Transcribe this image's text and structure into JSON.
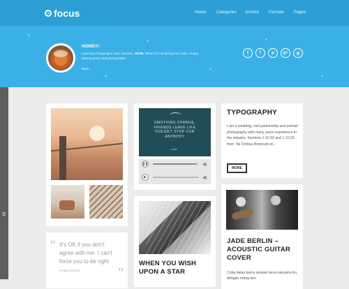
{
  "brand": {
    "name": "focus"
  },
  "nav": {
    "items": [
      "Home",
      "Categories",
      "Archive",
      "Formats",
      "Pages"
    ]
  },
  "hero": {
    "greeting": "HOWDY!",
    "intro_pre": "Learning 2 languages now: German,",
    "intro_bold": "JSON",
    "intro_post": ". When I'm not diving into code, I enjoy playing piano and photographs.",
    "more": "More..."
  },
  "socials": [
    {
      "icon": "twitter-icon",
      "glyph": "t"
    },
    {
      "icon": "facebook-icon",
      "glyph": "f"
    },
    {
      "icon": "pinterest-icon",
      "glyph": "p"
    },
    {
      "icon": "google-plus-icon",
      "glyph": "g+"
    },
    {
      "icon": "instagram-icon",
      "glyph": "◎"
    }
  ],
  "quote": {
    "text": "It's OK if you don't agree with me. I can't force you to be right",
    "author": "Serjah Drovne"
  },
  "audio": {
    "video_text": "EMOTIONS CHANGE, FRIENDS LEAVE LIFE DOESN'T STOP FOR ANYBODY",
    "video_small": "Love"
  },
  "posts": {
    "wish": {
      "title": "WHEN YOU WISH UPON A STAR"
    },
    "typography": {
      "title": "TYPOGRAPHY",
      "body": "I am a wedding, civil partnership and portrait photography with many years experience in the industry. Sections 1.10.32 and 1.10.33 from \"de Finibus Bonorum et...",
      "more": "MORE"
    },
    "jade": {
      "title": "JADE BERLIN – ACOUSTIC GUITAR COVER",
      "body": "Coba kalau kamu simpan terus karyamu itu, dengan orang lain"
    }
  },
  "colors": {
    "topbar": "#2b9fd6",
    "hero": "#3bb0e6",
    "background": "#ececec"
  }
}
